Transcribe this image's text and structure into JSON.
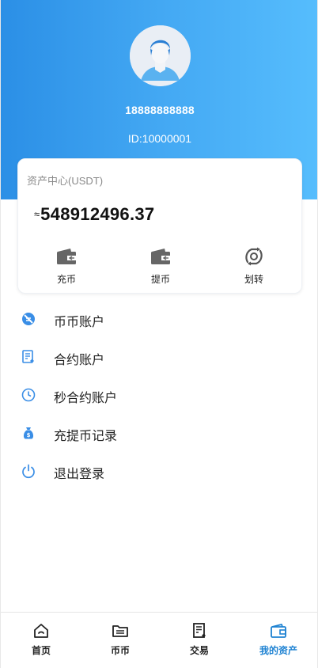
{
  "profile": {
    "phone": "18888888888",
    "user_id": "ID:10000001"
  },
  "asset_card": {
    "title": "资产中心(USDT)",
    "approx_symbol": "≈",
    "balance": "548912496.37",
    "actions": [
      {
        "label": "充币",
        "icon": "wallet-deposit-icon"
      },
      {
        "label": "提币",
        "icon": "wallet-withdraw-icon"
      },
      {
        "label": "划转",
        "icon": "transfer-icon"
      }
    ]
  },
  "menu": [
    {
      "label": "币币账户",
      "icon": "spot-account-icon"
    },
    {
      "label": "合约账户",
      "icon": "contract-account-icon"
    },
    {
      "label": "秒合约账户",
      "icon": "clock-icon"
    },
    {
      "label": "充提币记录",
      "icon": "money-bag-icon"
    },
    {
      "label": "退出登录",
      "icon": "power-icon"
    }
  ],
  "tabbar": [
    {
      "label": "首页",
      "icon": "home-icon",
      "active": false
    },
    {
      "label": "币币",
      "icon": "folder-icon",
      "active": false
    },
    {
      "label": "交易",
      "icon": "trade-doc-icon",
      "active": false
    },
    {
      "label": "我的资产",
      "icon": "wallet-icon",
      "active": true
    }
  ],
  "colors": {
    "header_gradient_start": "#2b8fe6",
    "header_gradient_end": "#56bdfd",
    "accent": "#1e82d2",
    "menu_icon": "#3a8ee6"
  }
}
